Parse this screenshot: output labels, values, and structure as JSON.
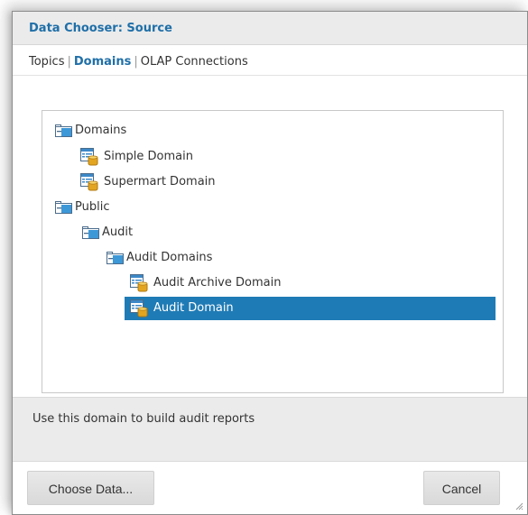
{
  "dialog": {
    "title": "Data Chooser: Source"
  },
  "tabs": [
    {
      "label": "Topics",
      "active": false
    },
    {
      "label": "Domains",
      "active": true
    },
    {
      "label": "OLAP Connections",
      "active": false
    }
  ],
  "tabs_separator": "|",
  "tree": {
    "nodes": [
      {
        "label": "Domains",
        "type": "folder",
        "expanded": true,
        "level": 0
      },
      {
        "label": "Simple Domain",
        "type": "domain",
        "level": 1
      },
      {
        "label": "Supermart Domain",
        "type": "domain",
        "level": 1
      },
      {
        "label": "Public",
        "type": "folder",
        "expanded": true,
        "level": 0
      },
      {
        "label": "Audit",
        "type": "folder",
        "expanded": true,
        "level": 1
      },
      {
        "label": "Audit Domains",
        "type": "folder",
        "expanded": true,
        "level": 2
      },
      {
        "label": "Audit Archive Domain",
        "type": "domain",
        "level": 3
      },
      {
        "label": "Audit Domain",
        "type": "domain",
        "level": 3,
        "selected": true
      }
    ]
  },
  "description": "Use this domain to build audit reports",
  "buttons": {
    "choose": "Choose Data...",
    "cancel": "Cancel"
  },
  "colors": {
    "accent": "#1f6fa8",
    "selection": "#1f7bb5",
    "panel_bg": "#ebebeb"
  },
  "icons": {
    "folder": "folder-expanded-icon",
    "domain": "domain-table-icon",
    "resize": "resize-grip-icon"
  }
}
